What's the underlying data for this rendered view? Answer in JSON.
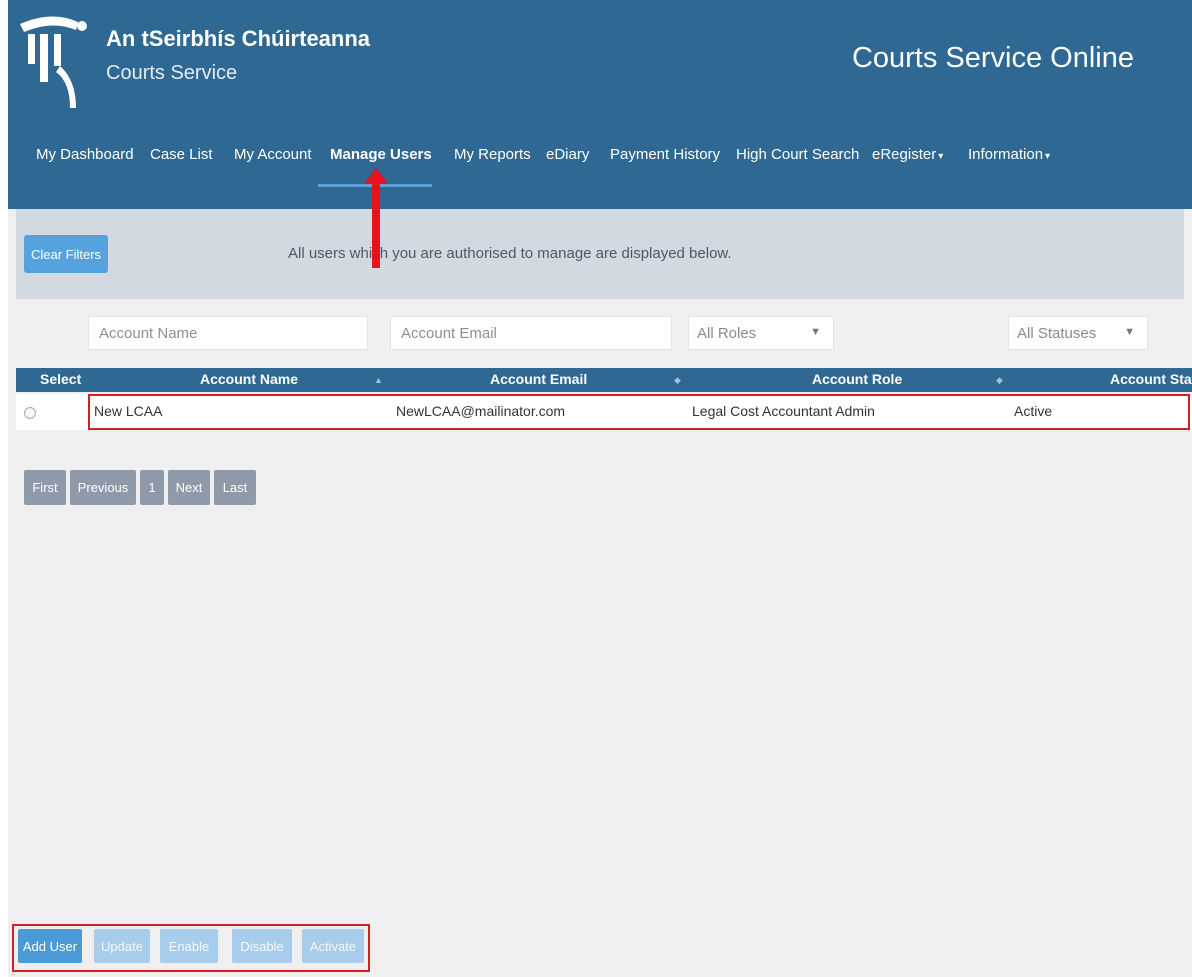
{
  "header": {
    "brand_irish": "An tSeirbhís Chúirteanna",
    "brand_english": "Courts Service",
    "site_title": "Courts Service Online"
  },
  "nav": {
    "items": [
      {
        "label": "My Dashboard"
      },
      {
        "label": "Case List"
      },
      {
        "label": "My Account"
      },
      {
        "label": "Manage Users",
        "active": true
      },
      {
        "label": "My Reports"
      },
      {
        "label": "eDiary"
      },
      {
        "label": "Payment History"
      },
      {
        "label": "High Court Search"
      },
      {
        "label": "eRegister",
        "dropdown": true
      },
      {
        "label": "Information",
        "dropdown": true
      }
    ]
  },
  "banner": {
    "clear_filters": "Clear Filters",
    "info": "All users which you are authorised to manage are displayed below."
  },
  "filters": {
    "account_name_placeholder": "Account Name",
    "account_email_placeholder": "Account Email",
    "roles_selected": "All Roles",
    "statuses_selected": "All Statuses"
  },
  "table": {
    "headers": [
      "Select",
      "Account Name",
      "Account Email",
      "Account Role",
      "Account Status"
    ],
    "rows": [
      {
        "name": "New LCAA",
        "email": "NewLCAA@mailinator.com",
        "role": "Legal Cost Accountant Admin",
        "status": "Active"
      }
    ]
  },
  "pagination": {
    "first": "First",
    "previous": "Previous",
    "page": "1",
    "next": "Next",
    "last": "Last"
  },
  "actions": {
    "add_user": "Add User",
    "update": "Update",
    "enable": "Enable",
    "disable": "Disable",
    "activate": "Activate"
  },
  "colors": {
    "header_bg": "#2e6893",
    "banner_bg": "#d3d9e0",
    "accent_blue": "#55a3de",
    "highlight_red": "#d61c25"
  }
}
